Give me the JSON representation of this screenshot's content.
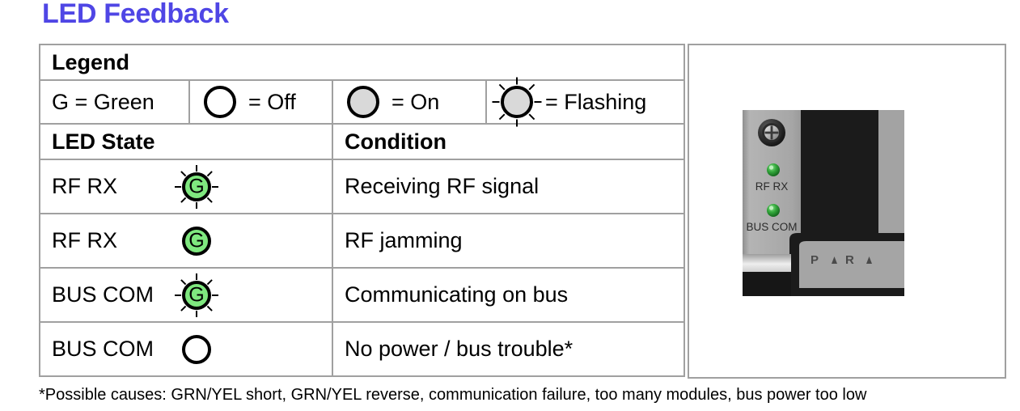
{
  "page": {
    "title": "LED Feedback",
    "title_color": "#4f46e5"
  },
  "legend": {
    "heading": "Legend",
    "keys": [
      {
        "text": "G = Green",
        "icon": "none"
      },
      {
        "text": "= Off",
        "icon": "circle-off-icon"
      },
      {
        "text": "= On",
        "icon": "circle-on-icon"
      },
      {
        "text": "= Flashing",
        "icon": "circle-flashing-icon"
      }
    ]
  },
  "table": {
    "headers": {
      "state": "LED State",
      "condition": "Condition"
    },
    "rows": [
      {
        "state": "RF RX",
        "led_letter": "G",
        "led_icon": "led-green-flashing-icon",
        "led_state": "flashing",
        "condition": "Receiving RF signal"
      },
      {
        "state": "RF RX",
        "led_letter": "G",
        "led_icon": "led-green-on-icon",
        "led_state": "on",
        "condition": "RF jamming"
      },
      {
        "state": "BUS COM",
        "led_letter": "G",
        "led_icon": "led-green-flashing-icon",
        "led_state": "flashing",
        "condition": "Communicating on bus"
      },
      {
        "state": "BUS COM",
        "led_letter": "",
        "led_icon": "led-off-icon",
        "led_state": "off",
        "condition": "No power / bus trouble*"
      }
    ]
  },
  "photo": {
    "alt": "module-front-panel-photo",
    "led_labels": [
      "RF RX",
      "BUS COM"
    ],
    "brand_text": "P ▲ R ▲",
    "colors": {
      "panel_gray": "#a8a8a8",
      "dark_body": "#1d1d1d",
      "led_green": "#1f9f2f"
    }
  },
  "footnote": {
    "text": "*Possible causes: GRN/YEL short, GRN/YEL reverse, communication failure, too many modules, bus power too low"
  }
}
